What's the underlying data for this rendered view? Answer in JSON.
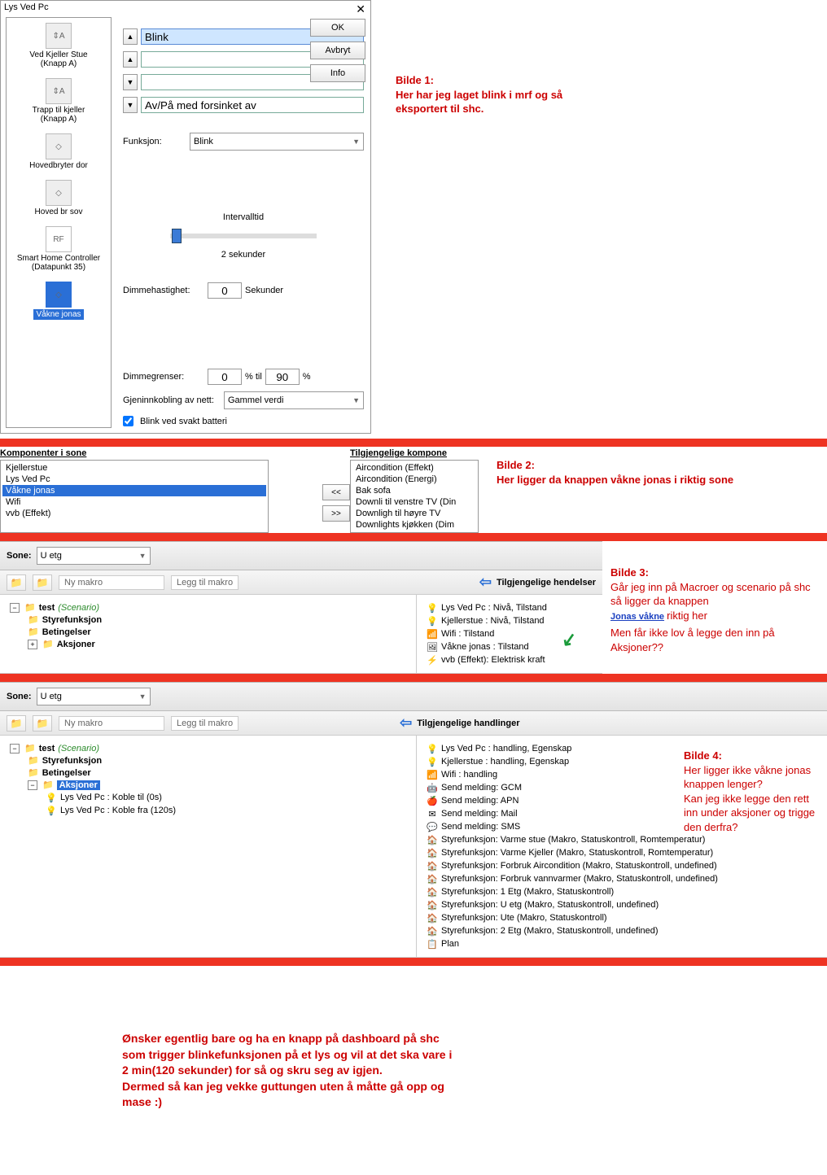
{
  "dialog1": {
    "title": "Lys Ved Pc",
    "close": "✕",
    "devices": [
      {
        "label": "Ved Kjeller Stue\n(Knapp A)",
        "icon": "⇕A"
      },
      {
        "label": "Trapp til kjeller\n(Knapp A)",
        "icon": "⇕A"
      },
      {
        "label": "Hovedbryter dor",
        "icon": "◇"
      },
      {
        "label": "Hoved br sov",
        "icon": "◇"
      },
      {
        "label": "Smart Home Controller\n(Datapunkt 35)",
        "icon": "RF"
      },
      {
        "label": "Våkne jonas",
        "icon": "◇",
        "selected": true
      }
    ],
    "buttons": {
      "ok": "OK",
      "avbryt": "Avbryt",
      "info": "Info"
    },
    "fields": {
      "f1": "Blink",
      "f4": "Av/På med forsinket av"
    },
    "funksjon_lbl": "Funksjon:",
    "funksjon_val": "Blink",
    "intervall_lbl": "Intervalltid",
    "intervall_val": "2 sekunder",
    "dimme_lbl": "Dimmehastighet:",
    "dimme_val": "0",
    "dimme_unit": "Sekunder",
    "grenser_lbl": "Dimmegrenser:",
    "grenser_lo": "0",
    "grenser_hi": "90",
    "pct": "%",
    "til": "% til",
    "gjen_lbl": "Gjeninnkobling av nett:",
    "gjen_val": "Gammel verdi",
    "blink_cb": "Blink ved svakt batteri"
  },
  "ann1": {
    "title": "Bilde 1:",
    "body": "Her har jeg laget blink i mrf og så eksportert til shc."
  },
  "sec2": {
    "left_head": "Komponenter i sone",
    "left_items": [
      "Kjellerstue",
      "Lys Ved Pc",
      "Våkne jonas",
      "Wifi",
      "vvb (Effekt)"
    ],
    "left_sel_idx": 2,
    "right_head": "Tilgjengelige kompone",
    "right_items": [
      "Aircondition (Effekt)",
      "Aircondition (Energi)",
      "Bak sofa",
      "Downli til venstre TV (Din",
      "Downligh til høyre TV",
      "Downlights kjøkken (Dim"
    ],
    "btn_left": "<<",
    "btn_right": ">>"
  },
  "ann2": {
    "title": "Bilde 2:",
    "body": "Her ligger da knappen våkne  jonas  i riktig sone"
  },
  "macro3": {
    "sone_lbl": "Sone:",
    "sone_val": "U etg",
    "ny_makro": "Ny makro",
    "legg_til": "Legg til makro",
    "hdr_right": "Tilgjengelige hendelser",
    "tree_root": "test",
    "tree_root_suffix": "(Scenario)",
    "tree_children": [
      "Styrefunksjon",
      "Betingelser",
      "Aksjoner"
    ],
    "events": [
      {
        "txt": "Lys Ved Pc : Nivå, Tilstand",
        "ic": "💡"
      },
      {
        "txt": "Kjellerstue : Nivå, Tilstand",
        "ic": "💡"
      },
      {
        "txt": "Wifi : Tilstand",
        "ic": "📶"
      },
      {
        "txt": "Våkne jonas : Tilstand",
        "ic": "🖼"
      },
      {
        "txt": "vvb (Effekt): Elektrisk kraft",
        "ic": "⚡"
      }
    ]
  },
  "ann3": {
    "title": "Bilde 3:",
    "l1": "Går jeg inn på Macroer og scenario  på shc",
    "l2": "så ligger da knappen",
    "l3": "Jonas våkne",
    "l4": "riktig her",
    "l5": "Men får ikke lov å legge den inn på Aksjoner??"
  },
  "macro4": {
    "sone_lbl": "Sone:",
    "sone_val": "U etg",
    "ny_makro": "Ny makro",
    "legg_til": "Legg til makro",
    "hdr_right": "Tilgjengelige handlinger",
    "tree_root": "test",
    "tree_root_suffix": "(Scenario)",
    "tree_children": [
      "Styrefunksjon",
      "Betingelser"
    ],
    "aksjoner": "Aksjoner",
    "actions": [
      "Lys Ved Pc : Koble til (0s)",
      "Lys Ved Pc : Koble fra (120s)"
    ],
    "events": [
      {
        "txt": "Lys Ved Pc : handling, Egenskap",
        "ic": "💡"
      },
      {
        "txt": "Kjellerstue : handling, Egenskap",
        "ic": "💡"
      },
      {
        "txt": "Wifi : handling",
        "ic": "📶"
      },
      {
        "txt": "Send melding: GCM",
        "ic": "🤖"
      },
      {
        "txt": "Send melding: APN",
        "ic": "🍎"
      },
      {
        "txt": "Send melding: Mail",
        "ic": "✉"
      },
      {
        "txt": "Send melding: SMS",
        "ic": "💬"
      },
      {
        "txt": "Styrefunksjon: Varme stue (Makro, Statuskontroll, Romtemperatur)",
        "ic": "🏠"
      },
      {
        "txt": "Styrefunksjon: Varme Kjeller (Makro, Statuskontroll, Romtemperatur)",
        "ic": "🏠"
      },
      {
        "txt": "Styrefunksjon: Forbruk Aircondition (Makro, Statuskontroll, undefined)",
        "ic": "🏠"
      },
      {
        "txt": "Styrefunksjon: Forbruk vannvarmer (Makro, Statuskontroll, undefined)",
        "ic": "🏠"
      },
      {
        "txt": "Styrefunksjon: 1 Etg (Makro, Statuskontroll)",
        "ic": "🏠"
      },
      {
        "txt": "Styrefunksjon: U etg (Makro, Statuskontroll, undefined)",
        "ic": "🏠"
      },
      {
        "txt": "Styrefunksjon: Ute (Makro, Statuskontroll)",
        "ic": "🏠"
      },
      {
        "txt": "Styrefunksjon: 2 Etg (Makro, Statuskontroll, undefined)",
        "ic": "🏠"
      },
      {
        "txt": "Plan",
        "ic": "📋"
      }
    ]
  },
  "ann4": {
    "title": "Bilde 4:",
    "body": "Her ligger ikke våkne jonas knappen lenger?\nKan jeg ikke legge den rett inn under aksjoner og trigge den derfra?"
  },
  "bottom": "Ønsker egentlig bare og ha en knapp på dashboard på shc som trigger blinkefunksjonen på et lys og vil at det ska vare i 2 min(120 sekunder) for så og skru seg av igjen.\nDermed så kan jeg vekke guttungen uten å måtte gå opp og mase :)"
}
